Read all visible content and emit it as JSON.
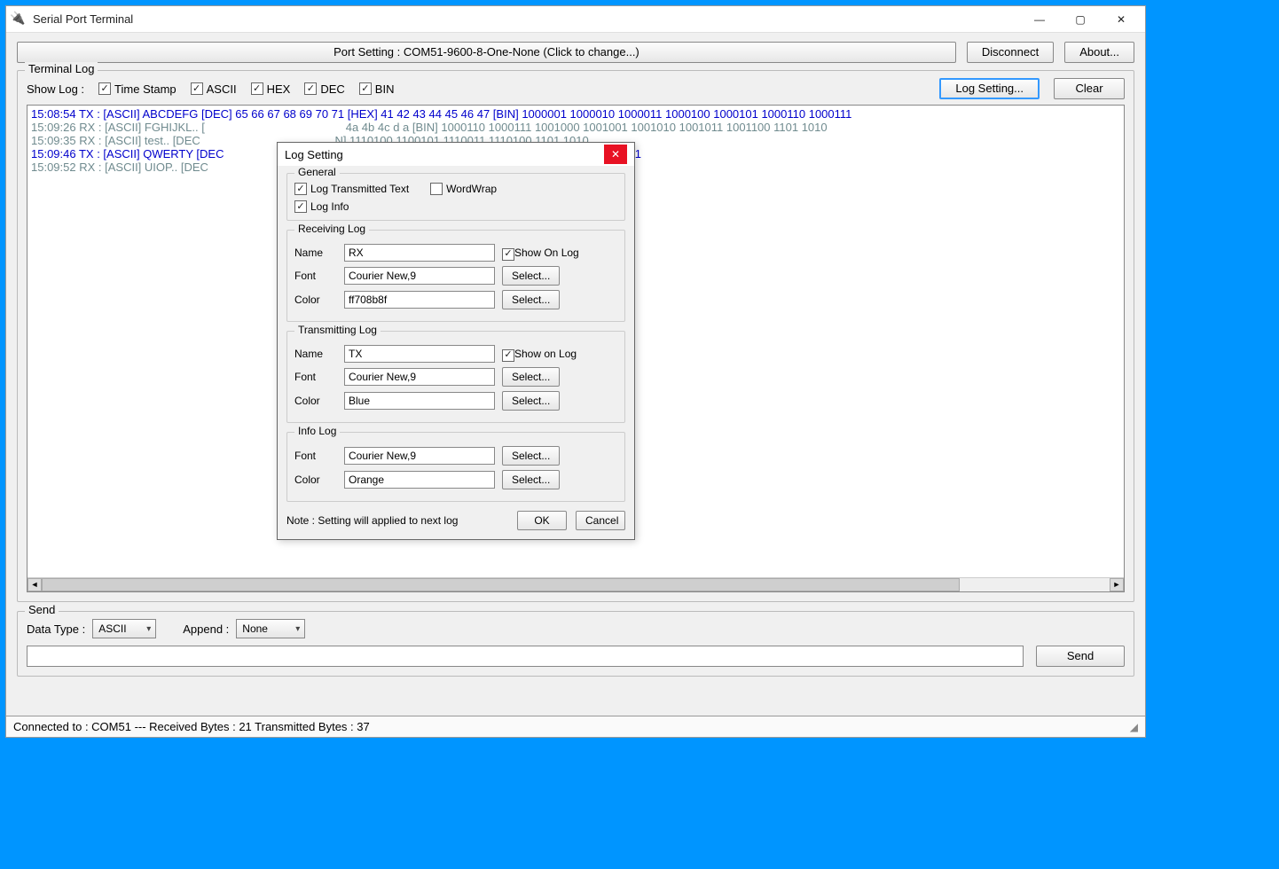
{
  "window": {
    "title": "Serial Port Terminal"
  },
  "topbar": {
    "port_setting": "Port Setting : COM51-9600-8-One-None (Click to change...)",
    "disconnect": "Disconnect",
    "about": "About..."
  },
  "terminal": {
    "title": "Terminal Log",
    "show_log": "Show Log :",
    "cb_timestamp": "Time Stamp",
    "cb_ascii": "ASCII",
    "cb_hex": "HEX",
    "cb_dec": "DEC",
    "cb_bin": "BIN",
    "log_setting_btn": "Log Setting...",
    "clear_btn": "Clear",
    "lines": [
      {
        "cls": "tx",
        "text": "15:08:54 TX : [ASCII] ABCDEFG [DEC] 65 66 67 68 69 70 71 [HEX] 41 42 43 44 45 46 47 [BIN] 1000001 1000010 1000011 1000100 1000101 1000110 1000111"
      },
      {
        "cls": "rx",
        "text": "15:09:26 RX : [ASCII] FGHIJKL.. [                                            4a 4b 4c d a [BIN] 1000110 1000111 1001000 1001001 1001010 1001011 1001100 1101 1010"
      },
      {
        "cls": "rx",
        "text": "15:09:35 RX : [ASCII] test.. [DEC                                          N] 1110100 1100101 1110011 1110100 1101 1010"
      },
      {
        "cls": "tx",
        "text": "15:09:46 TX : [ASCII] QWERTY [DEC                                          1010001 1010111 1000101 1010010 1010100 1011001"
      },
      {
        "cls": "rx",
        "text": "15:09:52 RX : [ASCII] UIOP.. [DEC                                          010101 1001001 1001111 1010000 1101 1010"
      }
    ]
  },
  "send": {
    "title": "Send",
    "datatype_label": "Data Type :",
    "datatype_value": "ASCII",
    "append_label": "Append :",
    "append_value": "None",
    "input_value": "",
    "send_btn": "Send"
  },
  "status": {
    "text": "Connected to : COM51  ---  Received Bytes :  21  Transmitted Bytes :  37"
  },
  "dialog": {
    "title": "Log Setting",
    "general": {
      "title": "General",
      "log_tx": "Log Transmitted Text",
      "wordwrap": "WordWrap",
      "log_info": "Log Info"
    },
    "rx": {
      "title": "Receiving Log",
      "name_lbl": "Name",
      "name_val": "RX",
      "show_on_log": "Show On Log",
      "font_lbl": "Font",
      "font_val": "Courier New,9",
      "color_lbl": "Color",
      "color_val": "ff708b8f",
      "select_btn": "Select..."
    },
    "tx": {
      "title": "Transmitting Log",
      "name_lbl": "Name",
      "name_val": "TX",
      "show_on_log": "Show on Log",
      "font_lbl": "Font",
      "font_val": "Courier New,9",
      "color_lbl": "Color",
      "color_val": "Blue",
      "select_btn": "Select..."
    },
    "info": {
      "title": "Info Log",
      "font_lbl": "Font",
      "font_val": "Courier New,9",
      "color_lbl": "Color",
      "color_val": "Orange",
      "select_btn": "Select..."
    },
    "note": "Note : Setting will applied to next log",
    "ok": "OK",
    "cancel": "Cancel"
  }
}
